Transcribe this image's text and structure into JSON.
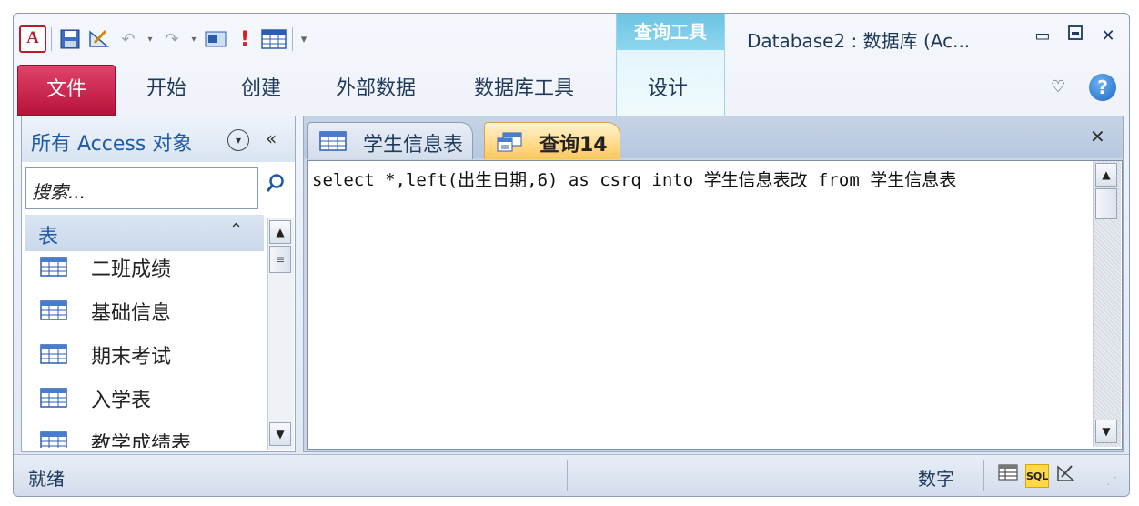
{
  "title_bar": {
    "app_icon": "A",
    "window_title": "Database2 : 数据库 (Ac...",
    "context_group": "查询工具",
    "quick_access": [
      "save-icon",
      "design-icon",
      "undo-icon",
      "redo-icon",
      "view-icon",
      "run-icon",
      "table-icon",
      "customize-icon"
    ],
    "controls": {
      "minimize": "▭",
      "restore": "▫",
      "close": "✕"
    }
  },
  "ribbon": {
    "file_tab": "文件",
    "tabs": [
      "开始",
      "创建",
      "外部数据",
      "数据库工具"
    ],
    "context_tab": "设计",
    "help": "?",
    "collapse": "♡"
  },
  "nav_pane": {
    "title": "所有 Access 对象",
    "search_placeholder": "搜索...",
    "group_label": "表",
    "items": [
      "二班成绩",
      "基础信息",
      "期末考试",
      "入学表",
      "教学成绩表"
    ]
  },
  "documents": {
    "tabs": [
      {
        "label": "学生信息表",
        "icon": "table-icon",
        "active": false
      },
      {
        "label": "查询14",
        "icon": "query-icon",
        "active": true
      }
    ],
    "close": "✕",
    "sql_text": "select *,left(出生日期,6) as csrq into 学生信息表改 from 学生信息表"
  },
  "status_bar": {
    "status": "就绪",
    "num_lock": "数字",
    "views": [
      "datasheet-view-icon",
      "SQL",
      "design-view-icon"
    ]
  },
  "colors": {
    "file_tab": "#c8164a",
    "accent": "#1e5aa8",
    "context": "#6cc4e3",
    "active_tab": "#ffc85a"
  }
}
